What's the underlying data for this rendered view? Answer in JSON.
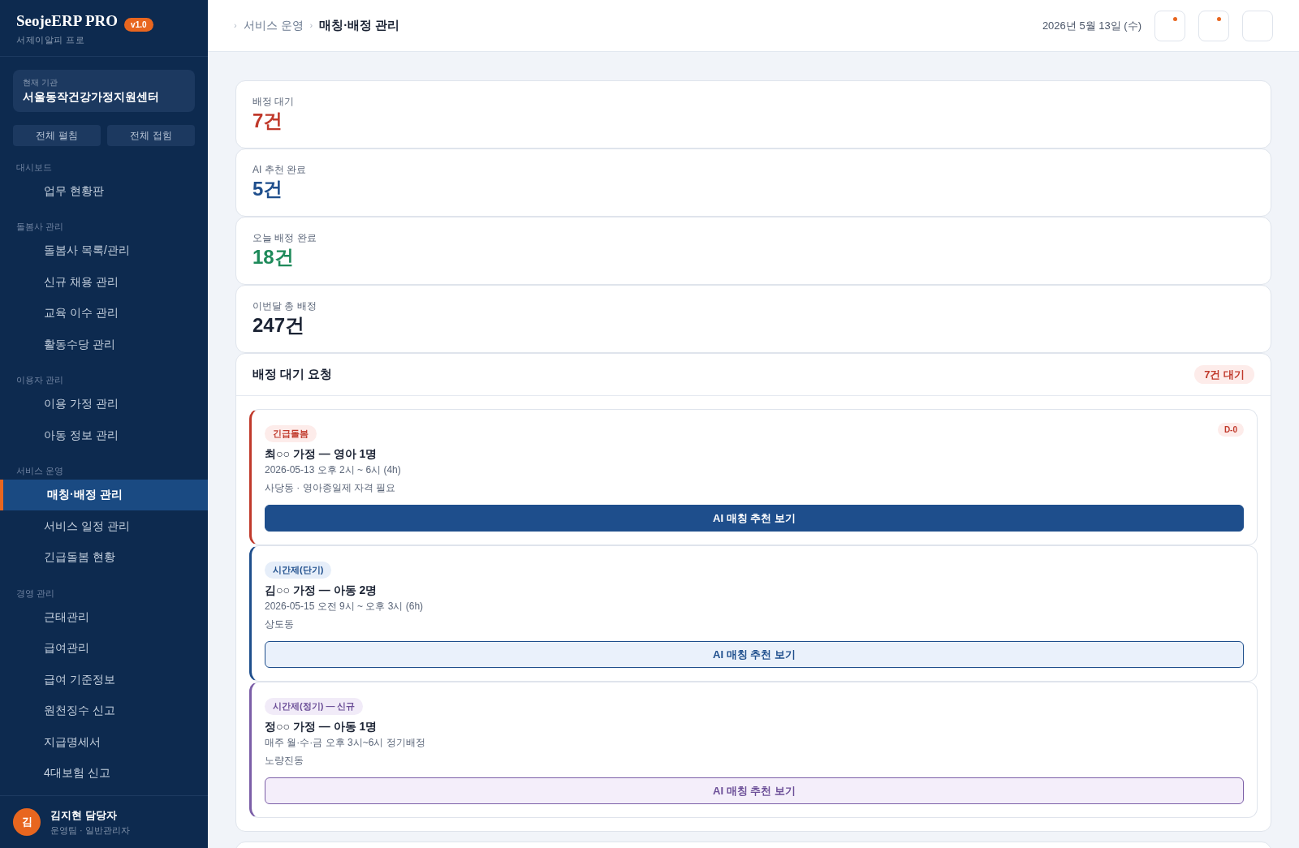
{
  "brand": {
    "name": "SeojeERP PRO",
    "version": "v1.0",
    "subtitle": "서제이알피 프로"
  },
  "org": {
    "label": "현재 기관",
    "name": "서울동작건강가정지원센터"
  },
  "expand_buttons": [
    "전체 펼침",
    "전체 접힘"
  ],
  "sidebar": [
    {
      "heading": "대시보드",
      "items": [
        {
          "label": "업무 현황판",
          "selected": false
        }
      ]
    },
    {
      "heading": "돌봄사 관리",
      "items": [
        {
          "label": "돌봄사 목록/관리",
          "selected": false
        },
        {
          "label": "신규 채용 관리",
          "selected": false
        },
        {
          "label": "교육 이수 관리",
          "selected": false
        },
        {
          "label": "활동수당 관리",
          "selected": false
        }
      ]
    },
    {
      "heading": "이용자 관리",
      "items": [
        {
          "label": "이용 가정 관리",
          "selected": false
        },
        {
          "label": "아동 정보 관리",
          "selected": false
        }
      ]
    },
    {
      "heading": "서비스 운영",
      "items": [
        {
          "label": "매칭·배정 관리",
          "selected": true
        },
        {
          "label": "서비스 일정 관리",
          "selected": false
        },
        {
          "label": "긴급돌봄 현황",
          "selected": false
        }
      ]
    },
    {
      "heading": "경영 관리",
      "items": [
        {
          "label": "근태관리",
          "selected": false
        },
        {
          "label": "급여관리",
          "selected": false
        },
        {
          "label": "급여 기준정보",
          "selected": false
        },
        {
          "label": "원천징수 신고",
          "selected": false
        },
        {
          "label": "지급명세서",
          "selected": false
        },
        {
          "label": "4대보험 신고",
          "selected": false
        }
      ]
    }
  ],
  "user": {
    "initial": "김",
    "name": "김지현 담당자",
    "role": "운영팀 · 일반관리자"
  },
  "breadcrumb": [
    {
      "separator": "›",
      "label": "서비스 운영"
    },
    {
      "separator": "›",
      "label": "매칭·배정 관리"
    }
  ],
  "date": "2026년 5월 13일 (수)",
  "header_buttons": [
    {
      "has_dot": true
    },
    {
      "has_dot": true
    },
    {
      "has_dot": false
    }
  ],
  "stats": [
    {
      "label": "배정 대기",
      "value": "7건",
      "color": "#c0392b"
    },
    {
      "label": "AI 추천 완료",
      "value": "5건",
      "color": "#1e4e8c"
    },
    {
      "label": "오늘 배정 완료",
      "value": "18건",
      "color": "#1e8a5a"
    },
    {
      "label": "이번달 총 배정",
      "value": "247건",
      "color": "#1a2233"
    }
  ],
  "pending": {
    "title": "배정 대기 요청",
    "badge": "7건 대기",
    "requests": [
      {
        "kind": "urgent",
        "tag": "긴급돌봄",
        "due": "D-0",
        "title": "최○○ 가정 — 영아 1명",
        "time": "2026-05-13 오후 2시 ~ 6시 (4h)",
        "detail": "사당동 · 영아종일제 자격 필요",
        "button": "AI 매칭 추천 보기"
      },
      {
        "kind": "short",
        "tag": "시간제(단기)",
        "title": "김○○ 가정 — 아동 2명",
        "time": "2026-05-15 오전 9시 ~ 오후 3시 (6h)",
        "detail": "상도동",
        "button": "AI 매칭 추천 보기"
      },
      {
        "kind": "regular",
        "tag": "시간제(정기) — 신규",
        "title": "정○○ 가정 — 아동 1명",
        "time": "매주 월·수·금 오후 3시~6시 정기배정",
        "detail": "노량진동",
        "button": "AI 매칭 추천 보기"
      }
    ]
  },
  "results": {
    "kind": "panel"
  }
}
